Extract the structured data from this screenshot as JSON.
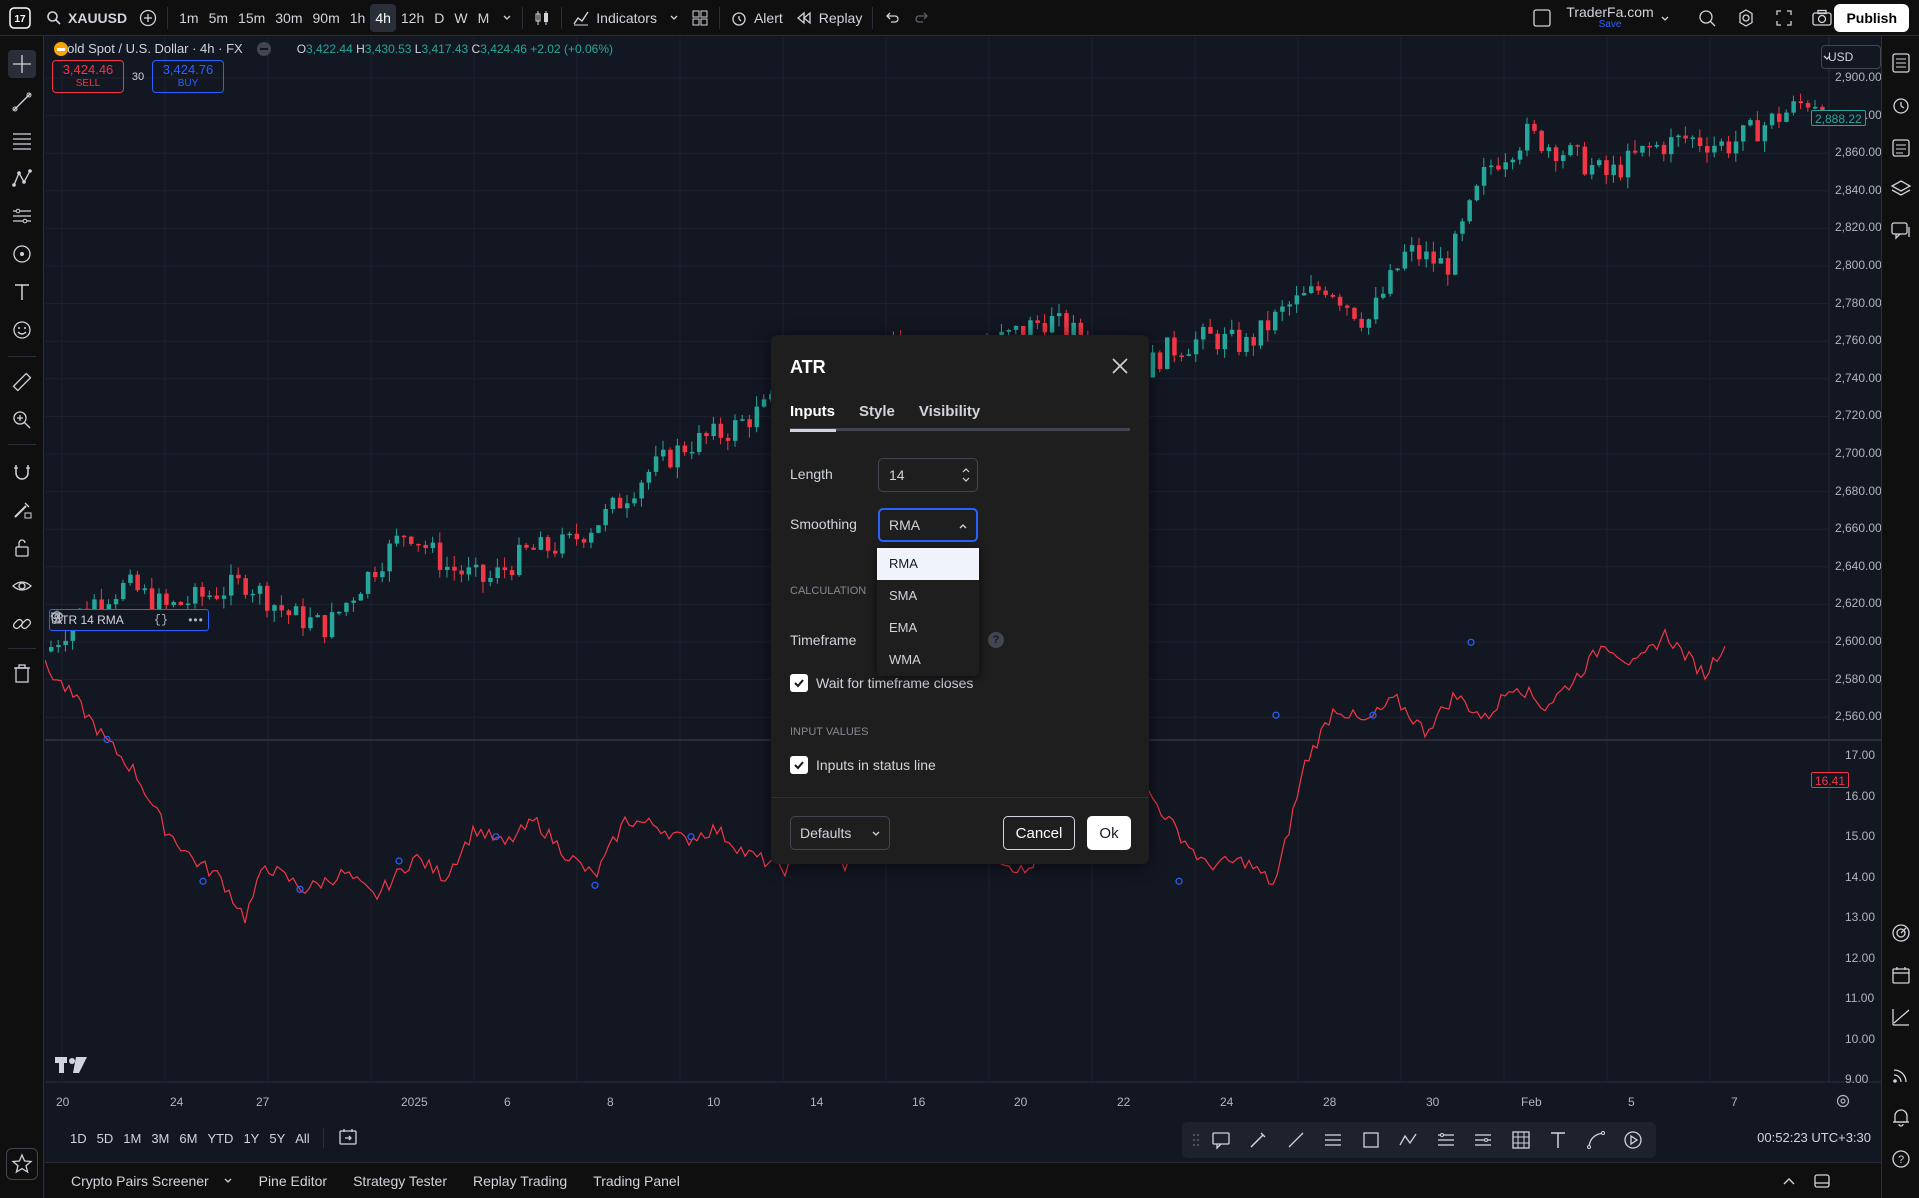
{
  "topbar": {
    "symbol": "XAUUSD",
    "timeframes": [
      "1m",
      "5m",
      "15m",
      "30m",
      "90m",
      "1h",
      "4h",
      "12h",
      "D",
      "W",
      "M"
    ],
    "active_timeframe": "4h",
    "indicators_label": "Indicators",
    "alert_label": "Alert",
    "replay_label": "Replay",
    "account_name": "TraderFa.com",
    "account_sub": "Save",
    "publish_label": "Publish"
  },
  "chart": {
    "title": "Gold Spot / U.S. Dollar · 4h · FX",
    "ohlc": {
      "o": "3,422.44",
      "h": "3,430.53",
      "l": "3,417.43",
      "c": "3,424.46",
      "change": "+2.02 (+0.06%)"
    },
    "sell_price": "3,424.46",
    "sell_label": "SELL",
    "buy_price": "3,424.76",
    "buy_label": "BUY",
    "spread": "30",
    "currency": "USD",
    "price_axis": [
      "2,900.00",
      "2,880.00",
      "2,860.00",
      "2,840.00",
      "2,820.00",
      "2,800.00",
      "2,780.00",
      "2,760.00",
      "2,740.00",
      "2,720.00",
      "2,700.00",
      "2,680.00",
      "2,660.00",
      "2,640.00",
      "2,620.00",
      "2,600.00",
      "2,580.00",
      "2,560.00"
    ],
    "last_price_tag": "2,888.22",
    "indicator_axis": [
      "17.00",
      "16.00",
      "15.00",
      "14.00",
      "13.00",
      "12.00",
      "11.00",
      "10.00",
      "9.00"
    ],
    "indicator_tag": "16.41",
    "indicator_label": "ATR 14 RMA",
    "time_axis": [
      "20",
      "24",
      "27",
      "2025",
      "6",
      "8",
      "10",
      "14",
      "16",
      "20",
      "22",
      "24",
      "28",
      "30",
      "Feb",
      "5",
      "7"
    ]
  },
  "timebar": {
    "ranges": [
      "1D",
      "5D",
      "1M",
      "3M",
      "6M",
      "YTD",
      "1Y",
      "5Y",
      "All"
    ],
    "clock": "00:52:23 UTC+3:30"
  },
  "bottompanel": {
    "tabs": [
      "Crypto Pairs Screener",
      "Pine Editor",
      "Strategy Tester",
      "Replay Trading",
      "Trading Panel"
    ]
  },
  "dialog": {
    "title": "ATR",
    "tabs": [
      "Inputs",
      "Style",
      "Visibility"
    ],
    "length_label": "Length",
    "length_value": "14",
    "smoothing_label": "Smoothing",
    "smoothing_value": "RMA",
    "smoothing_options": [
      "RMA",
      "SMA",
      "EMA",
      "WMA"
    ],
    "calculation_label": "CALCULATION",
    "timeframe_label": "Timeframe",
    "wait_label": "Wait for timeframe closes",
    "input_values_label": "INPUT VALUES",
    "status_line_label": "Inputs in status line",
    "defaults_label": "Defaults",
    "cancel_label": "Cancel",
    "ok_label": "Ok"
  },
  "colors": {
    "up": "#26a69a",
    "down": "#f23645",
    "atr": "#f23645",
    "accent": "#2962ff"
  }
}
